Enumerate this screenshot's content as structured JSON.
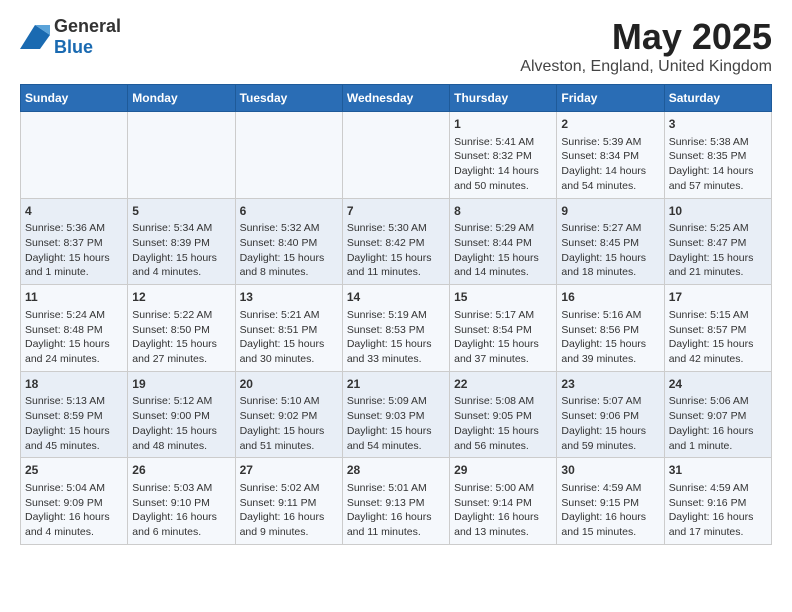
{
  "logo": {
    "text_general": "General",
    "text_blue": "Blue"
  },
  "title": "May 2025",
  "subtitle": "Alveston, England, United Kingdom",
  "days_of_week": [
    "Sunday",
    "Monday",
    "Tuesday",
    "Wednesday",
    "Thursday",
    "Friday",
    "Saturday"
  ],
  "weeks": [
    [
      {
        "day": "",
        "content": ""
      },
      {
        "day": "",
        "content": ""
      },
      {
        "day": "",
        "content": ""
      },
      {
        "day": "",
        "content": ""
      },
      {
        "day": "1",
        "content": "Sunrise: 5:41 AM\nSunset: 8:32 PM\nDaylight: 14 hours\nand 50 minutes."
      },
      {
        "day": "2",
        "content": "Sunrise: 5:39 AM\nSunset: 8:34 PM\nDaylight: 14 hours\nand 54 minutes."
      },
      {
        "day": "3",
        "content": "Sunrise: 5:38 AM\nSunset: 8:35 PM\nDaylight: 14 hours\nand 57 minutes."
      }
    ],
    [
      {
        "day": "4",
        "content": "Sunrise: 5:36 AM\nSunset: 8:37 PM\nDaylight: 15 hours\nand 1 minute."
      },
      {
        "day": "5",
        "content": "Sunrise: 5:34 AM\nSunset: 8:39 PM\nDaylight: 15 hours\nand 4 minutes."
      },
      {
        "day": "6",
        "content": "Sunrise: 5:32 AM\nSunset: 8:40 PM\nDaylight: 15 hours\nand 8 minutes."
      },
      {
        "day": "7",
        "content": "Sunrise: 5:30 AM\nSunset: 8:42 PM\nDaylight: 15 hours\nand 11 minutes."
      },
      {
        "day": "8",
        "content": "Sunrise: 5:29 AM\nSunset: 8:44 PM\nDaylight: 15 hours\nand 14 minutes."
      },
      {
        "day": "9",
        "content": "Sunrise: 5:27 AM\nSunset: 8:45 PM\nDaylight: 15 hours\nand 18 minutes."
      },
      {
        "day": "10",
        "content": "Sunrise: 5:25 AM\nSunset: 8:47 PM\nDaylight: 15 hours\nand 21 minutes."
      }
    ],
    [
      {
        "day": "11",
        "content": "Sunrise: 5:24 AM\nSunset: 8:48 PM\nDaylight: 15 hours\nand 24 minutes."
      },
      {
        "day": "12",
        "content": "Sunrise: 5:22 AM\nSunset: 8:50 PM\nDaylight: 15 hours\nand 27 minutes."
      },
      {
        "day": "13",
        "content": "Sunrise: 5:21 AM\nSunset: 8:51 PM\nDaylight: 15 hours\nand 30 minutes."
      },
      {
        "day": "14",
        "content": "Sunrise: 5:19 AM\nSunset: 8:53 PM\nDaylight: 15 hours\nand 33 minutes."
      },
      {
        "day": "15",
        "content": "Sunrise: 5:17 AM\nSunset: 8:54 PM\nDaylight: 15 hours\nand 37 minutes."
      },
      {
        "day": "16",
        "content": "Sunrise: 5:16 AM\nSunset: 8:56 PM\nDaylight: 15 hours\nand 39 minutes."
      },
      {
        "day": "17",
        "content": "Sunrise: 5:15 AM\nSunset: 8:57 PM\nDaylight: 15 hours\nand 42 minutes."
      }
    ],
    [
      {
        "day": "18",
        "content": "Sunrise: 5:13 AM\nSunset: 8:59 PM\nDaylight: 15 hours\nand 45 minutes."
      },
      {
        "day": "19",
        "content": "Sunrise: 5:12 AM\nSunset: 9:00 PM\nDaylight: 15 hours\nand 48 minutes."
      },
      {
        "day": "20",
        "content": "Sunrise: 5:10 AM\nSunset: 9:02 PM\nDaylight: 15 hours\nand 51 minutes."
      },
      {
        "day": "21",
        "content": "Sunrise: 5:09 AM\nSunset: 9:03 PM\nDaylight: 15 hours\nand 54 minutes."
      },
      {
        "day": "22",
        "content": "Sunrise: 5:08 AM\nSunset: 9:05 PM\nDaylight: 15 hours\nand 56 minutes."
      },
      {
        "day": "23",
        "content": "Sunrise: 5:07 AM\nSunset: 9:06 PM\nDaylight: 15 hours\nand 59 minutes."
      },
      {
        "day": "24",
        "content": "Sunrise: 5:06 AM\nSunset: 9:07 PM\nDaylight: 16 hours\nand 1 minute."
      }
    ],
    [
      {
        "day": "25",
        "content": "Sunrise: 5:04 AM\nSunset: 9:09 PM\nDaylight: 16 hours\nand 4 minutes."
      },
      {
        "day": "26",
        "content": "Sunrise: 5:03 AM\nSunset: 9:10 PM\nDaylight: 16 hours\nand 6 minutes."
      },
      {
        "day": "27",
        "content": "Sunrise: 5:02 AM\nSunset: 9:11 PM\nDaylight: 16 hours\nand 9 minutes."
      },
      {
        "day": "28",
        "content": "Sunrise: 5:01 AM\nSunset: 9:13 PM\nDaylight: 16 hours\nand 11 minutes."
      },
      {
        "day": "29",
        "content": "Sunrise: 5:00 AM\nSunset: 9:14 PM\nDaylight: 16 hours\nand 13 minutes."
      },
      {
        "day": "30",
        "content": "Sunrise: 4:59 AM\nSunset: 9:15 PM\nDaylight: 16 hours\nand 15 minutes."
      },
      {
        "day": "31",
        "content": "Sunrise: 4:59 AM\nSunset: 9:16 PM\nDaylight: 16 hours\nand 17 minutes."
      }
    ]
  ]
}
